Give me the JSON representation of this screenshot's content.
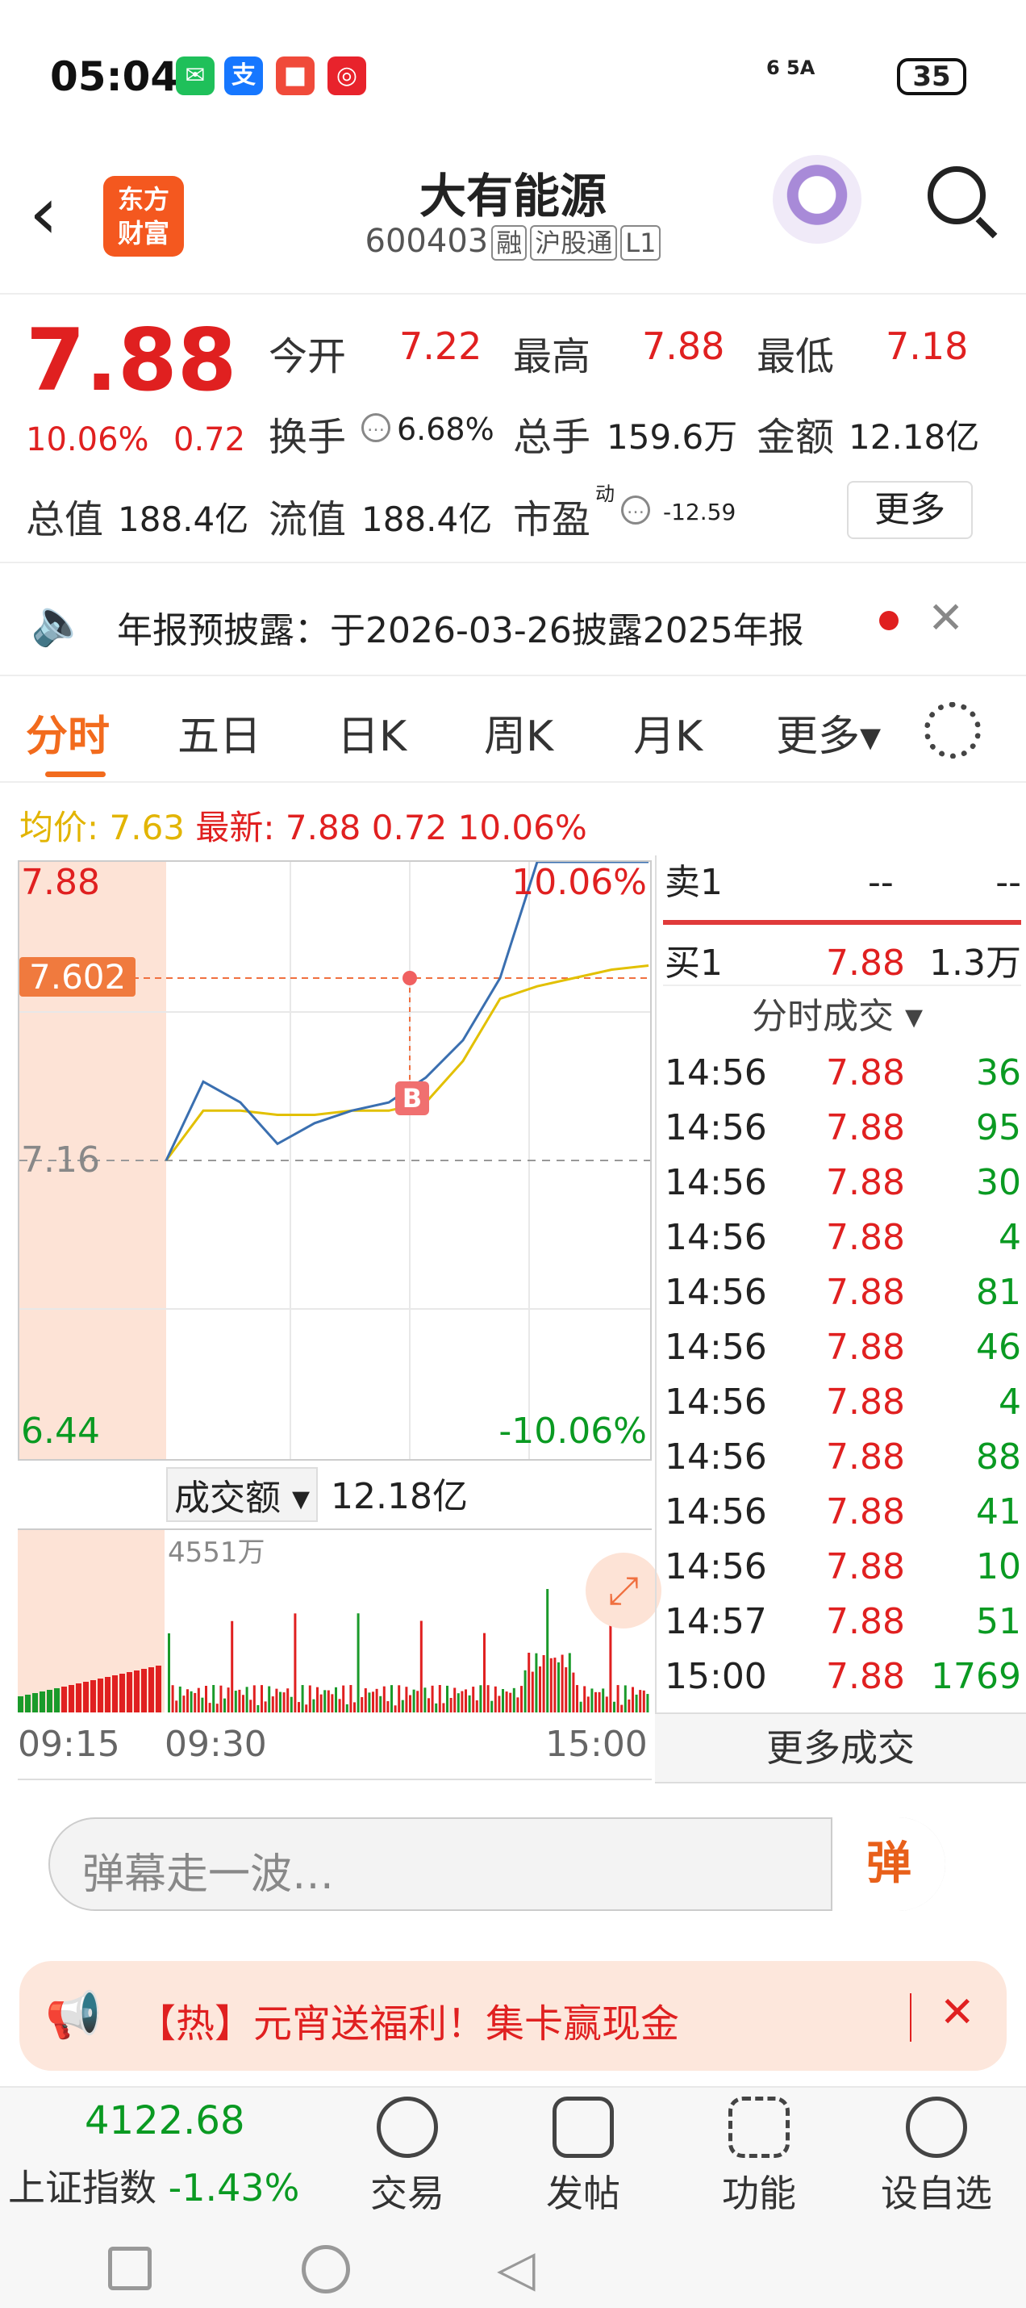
{
  "status_bar": {
    "time": "05:04",
    "signal": "6 5A",
    "battery": "35"
  },
  "header": {
    "logo_line1": "东方",
    "logo_line2": "财富",
    "stock_name": "大有能源",
    "stock_code": "600403",
    "tags": [
      "融",
      "沪股通",
      "L1"
    ]
  },
  "quote": {
    "price": "7.88",
    "change_pct": "10.06%",
    "change_amt": "0.72",
    "open_label": "今开",
    "open": "7.22",
    "high_label": "最高",
    "high": "7.88",
    "low_label": "最低",
    "low": "7.18",
    "turnover_label": "换手",
    "turnover": "6.68%",
    "volume_label": "总手",
    "volume": "159.6万",
    "amount_label": "金额",
    "amount": "12.18亿",
    "mktcap_label": "总值",
    "mktcap": "188.4亿",
    "float_label": "流值",
    "float": "188.4亿",
    "pe_label": "市盈",
    "pe_sup": "动",
    "pe": "-12.59",
    "more": "更多"
  },
  "notice": {
    "text": "年报预披露：于2026-03-26披露2025年报"
  },
  "tabs": [
    "分时",
    "五日",
    "日K",
    "周K",
    "月K",
    "更多▾"
  ],
  "chart": {
    "avg_label": "均价: 7.63",
    "latest_label": "最新: 7.88 0.72 10.06%",
    "top_price": "7.88",
    "top_pct": "10.06%",
    "cursor_price": "7.602",
    "prev_close": "7.16",
    "bottom_price": "6.44",
    "bottom_pct": "-10.06%",
    "marker": "B",
    "vol_selector": "成交额 ▾",
    "vol_total": "12.18亿",
    "vol_max": "4551万",
    "time_start": "09:15",
    "time_open": "09:30",
    "time_end": "15:00"
  },
  "chart_data": {
    "type": "line",
    "series": [
      {
        "name": "最新",
        "values": [
          7.16,
          7.35,
          7.3,
          7.2,
          7.25,
          7.28,
          7.3,
          7.36,
          7.45,
          7.6,
          7.88,
          7.88,
          7.88,
          7.88
        ]
      },
      {
        "name": "均价",
        "values": [
          7.16,
          7.28,
          7.28,
          7.27,
          7.27,
          7.28,
          7.28,
          7.3,
          7.4,
          7.55,
          7.58,
          7.6,
          7.62,
          7.63
        ]
      }
    ],
    "ylim": [
      6.44,
      7.88
    ]
  },
  "order_book": {
    "sell_label": "卖1",
    "sell_price": "--",
    "sell_vol": "--",
    "buy_label": "买1",
    "buy_price": "7.88",
    "buy_vol": "1.3万",
    "ticks_label": "分时成交 ▾"
  },
  "trades": [
    {
      "t": "14:56",
      "p": "7.88",
      "v": "36"
    },
    {
      "t": "14:56",
      "p": "7.88",
      "v": "95"
    },
    {
      "t": "14:56",
      "p": "7.88",
      "v": "30"
    },
    {
      "t": "14:56",
      "p": "7.88",
      "v": "4"
    },
    {
      "t": "14:56",
      "p": "7.88",
      "v": "81"
    },
    {
      "t": "14:56",
      "p": "7.88",
      "v": "46"
    },
    {
      "t": "14:56",
      "p": "7.88",
      "v": "4"
    },
    {
      "t": "14:56",
      "p": "7.88",
      "v": "88"
    },
    {
      "t": "14:56",
      "p": "7.88",
      "v": "41"
    },
    {
      "t": "14:56",
      "p": "7.88",
      "v": "10"
    },
    {
      "t": "14:57",
      "p": "7.88",
      "v": "51"
    },
    {
      "t": "15:00",
      "p": "7.88",
      "v": "1769"
    }
  ],
  "more_trades": "更多成交",
  "danmu": {
    "placeholder": "弹幕走一波…",
    "button": "弹"
  },
  "promo": {
    "text": "【热】元宵送福利！集卡赢现金",
    "close": "✕"
  },
  "bottom": {
    "index_value": "4122.68",
    "index_name": "上证指数",
    "index_change": "-1.43%",
    "nav": [
      "交易",
      "发帖",
      "功能",
      "设自选"
    ]
  }
}
